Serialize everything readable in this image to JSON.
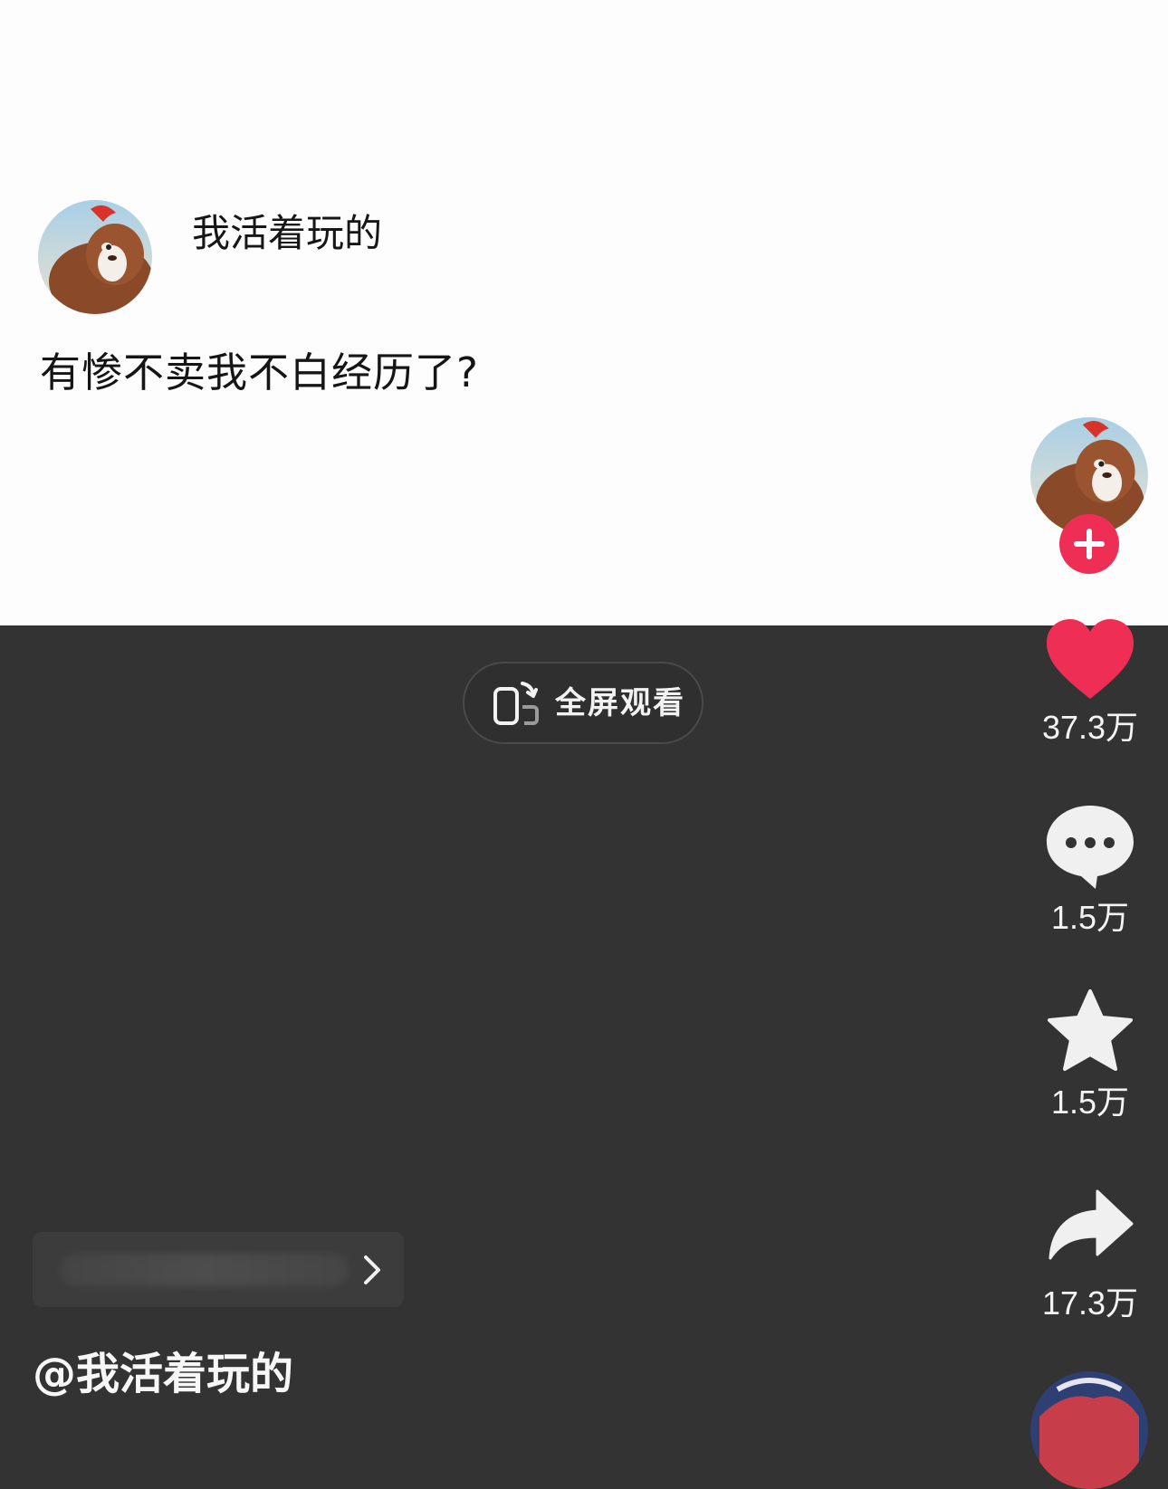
{
  "post": {
    "username": "我活着玩的",
    "text": "有惨不卖我不白经历了?"
  },
  "fullscreen": {
    "label": "全屏观看"
  },
  "actions": {
    "like_count": "37.3万",
    "comment_count": "1.5万",
    "favorite_count": "1.5万",
    "share_count": "17.3万"
  },
  "author": {
    "handle": "@我活着玩的"
  },
  "colors": {
    "accent": "#ef2e55",
    "video_bg": "#333333",
    "post_bg": "#fdfdfe"
  },
  "icons": [
    "bear-avatar-icon",
    "rotate-screen-icon",
    "plus-icon",
    "heart-icon",
    "comment-bubble-icon",
    "star-icon",
    "share-arrow-icon",
    "chevron-right-icon"
  ]
}
